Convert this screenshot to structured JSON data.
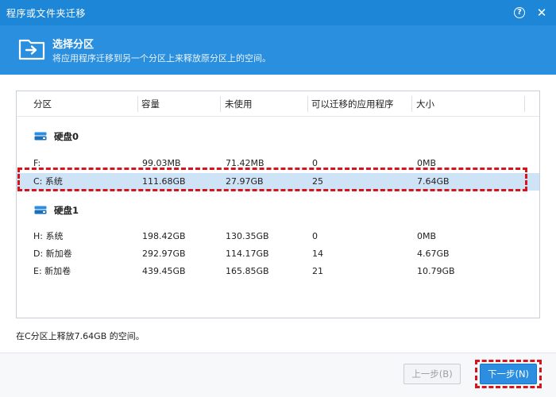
{
  "window": {
    "title": "程序或文件夹迁移"
  },
  "header": {
    "title": "选择分区",
    "subtitle": "将应用程序迁移到另一个分区上来释放原分区上的空间。"
  },
  "table": {
    "columns": [
      "分区",
      "容量",
      "未使用",
      "可以迁移的应用程序",
      "大小"
    ],
    "disks": [
      {
        "label": "硬盘0",
        "rows": [
          {
            "partition": "F:",
            "capacity": "99.03MB",
            "unused": "71.42MB",
            "apps": "0",
            "size": "0MB",
            "selected": false
          },
          {
            "partition": "C: 系统",
            "capacity": "111.68GB",
            "unused": "27.97GB",
            "apps": "25",
            "size": "7.64GB",
            "selected": true
          }
        ]
      },
      {
        "label": "硬盘1",
        "rows": [
          {
            "partition": "H: 系统",
            "capacity": "198.42GB",
            "unused": "130.35GB",
            "apps": "0",
            "size": "0MB",
            "selected": false
          },
          {
            "partition": "D: 新加卷",
            "capacity": "292.97GB",
            "unused": "114.17GB",
            "apps": "14",
            "size": "4.67GB",
            "selected": false
          },
          {
            "partition": "E: 新加卷",
            "capacity": "439.45GB",
            "unused": "165.85GB",
            "apps": "21",
            "size": "10.79GB",
            "selected": false
          }
        ]
      }
    ]
  },
  "footnote": "在C分区上释放7.64GB 的空间。",
  "buttons": {
    "prev": "上一步(B)",
    "next": "下一步(N)"
  },
  "icons": {
    "help": "help-icon",
    "close": "close-icon",
    "header": "folder-move-icon",
    "disk": "disk-icon"
  },
  "colors": {
    "titlebar": "#1d86d6",
    "header": "#2a8fde",
    "selected_row": "#cfe3f7",
    "highlight_frame": "#d8131a",
    "primary_button": "#2b8ee0"
  }
}
